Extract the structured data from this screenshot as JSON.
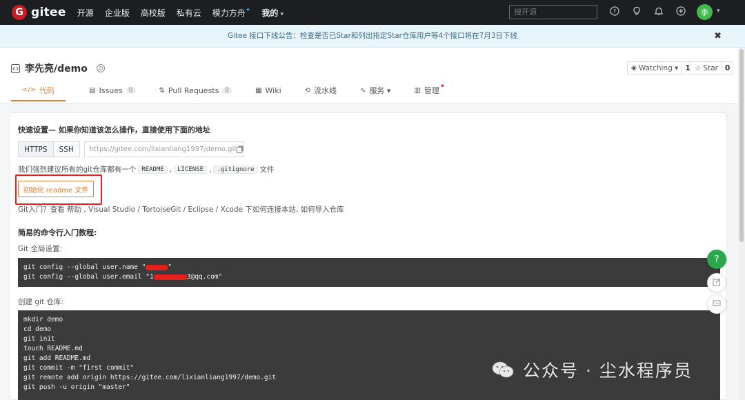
{
  "nav": {
    "logo_mark": "G",
    "logo_text": "gitee",
    "items": [
      "开源",
      "企业版",
      "高校版",
      "私有云",
      "模力方舟",
      "我的"
    ],
    "search_placeholder": "搜开源",
    "avatar_text": "李",
    "icons": [
      "question-circle-icon",
      "lightbulb-icon",
      "bell-icon",
      "plus-circle-icon"
    ]
  },
  "notice": {
    "text": "Gitee 接口下线公告：检查是否已Star和列出指定Star仓库用户等4个接口将在7月3日下线",
    "close": "✖"
  },
  "project": {
    "title": "李先亮/demo",
    "watch_label": "Watching ▾",
    "watch_count": "1",
    "star_label": "Star",
    "star_count": "0",
    "tabs": [
      {
        "label": "代码",
        "icon": "</>"
      },
      {
        "label": "Issues",
        "count": "0"
      },
      {
        "label": "Pull Requests",
        "count": "0"
      },
      {
        "label": "Wiki"
      },
      {
        "label": "流水线"
      },
      {
        "label": "服务 ▾"
      },
      {
        "label": "管理"
      }
    ]
  },
  "quick_setup": {
    "title": "快速设置— 如果你知道该怎么操作，直接使用下面的地址",
    "protocols": [
      "HTTPS",
      "SSH"
    ],
    "clone_url": "https://gitee.com/lixianliang1997/demo.git",
    "suggest_prefix": "我们强烈建议所有的git仓库都有一个",
    "suggest_files": [
      "README",
      "LICENSE",
      ".gitignore"
    ],
    "suggest_suffix": "文件",
    "init_button": "初始化 readme 文件",
    "help_text": "Git入门？查看 帮助 , Visual Studio / TortoiseGit / Eclipse / Xcode 下如何连接本站, 如何导入仓库"
  },
  "tutorial": {
    "title": "简易的命令行入门教程:",
    "global_label": "Git 全局设置:",
    "global_cmds": [
      "git config --global user.name \"",
      "git config --global user.email \"1",
      "3@qq.com\""
    ],
    "create_label": "创建 git 仓库:",
    "create_cmds": [
      "mkdir demo",
      "cd demo",
      "git init",
      "touch README.md",
      "git add README.md",
      "git commit -m \"first commit\"",
      "git remote add origin https://gitee.com/lixianliang1997/demo.git",
      "git push -u origin \"master\""
    ]
  },
  "floating": {
    "help": "?"
  },
  "watermark": {
    "text": "公众号 · 尘水程序员"
  },
  "colors": {
    "accent": "#e37c34",
    "brand": "#c71d23",
    "highlight": "#e5201d"
  }
}
